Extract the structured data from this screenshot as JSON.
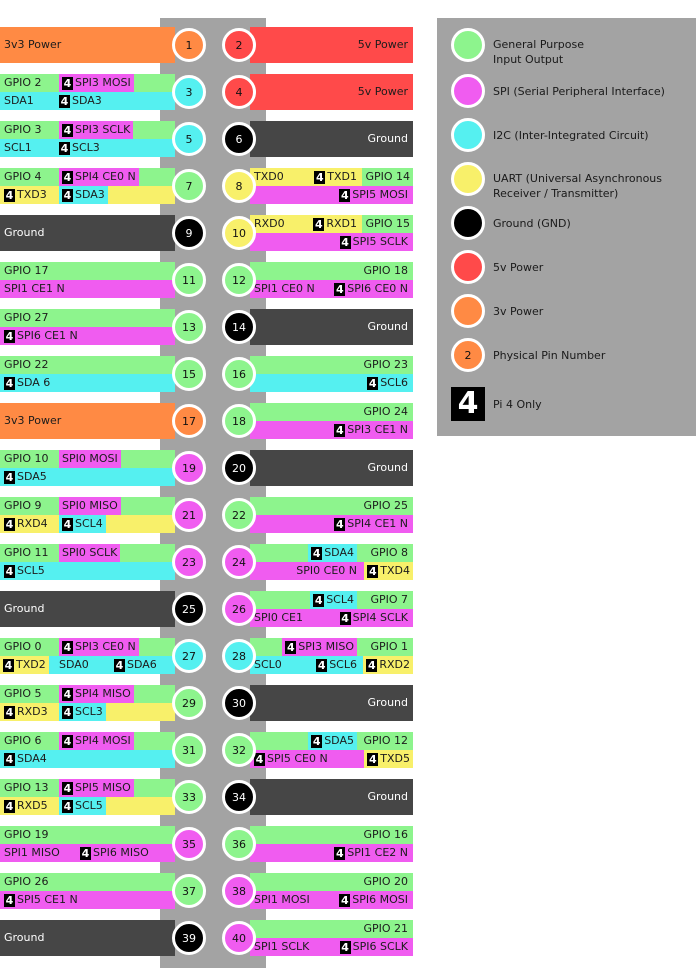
{
  "colors": {
    "gpio": "#8df48d",
    "spi": "#f05cf0",
    "i2c": "#55f0f0",
    "uart": "#f8f06a",
    "ground": "#464646",
    "power5": "#ff4a4a",
    "power3": "#ff8a44",
    "panel": "#a3a3a3"
  },
  "pins": [
    {
      "n": "1",
      "color": "power3"
    },
    {
      "n": "2",
      "color": "power5"
    },
    {
      "n": "3",
      "color": "i2c"
    },
    {
      "n": "4",
      "color": "power5"
    },
    {
      "n": "5",
      "color": "i2c"
    },
    {
      "n": "6",
      "color": "ground"
    },
    {
      "n": "7",
      "color": "gpio"
    },
    {
      "n": "8",
      "color": "uart"
    },
    {
      "n": "9",
      "color": "ground"
    },
    {
      "n": "10",
      "color": "uart"
    },
    {
      "n": "11",
      "color": "gpio"
    },
    {
      "n": "12",
      "color": "gpio"
    },
    {
      "n": "13",
      "color": "gpio"
    },
    {
      "n": "14",
      "color": "ground"
    },
    {
      "n": "15",
      "color": "gpio"
    },
    {
      "n": "16",
      "color": "gpio"
    },
    {
      "n": "17",
      "color": "power3"
    },
    {
      "n": "18",
      "color": "gpio"
    },
    {
      "n": "19",
      "color": "spi"
    },
    {
      "n": "20",
      "color": "ground"
    },
    {
      "n": "21",
      "color": "spi"
    },
    {
      "n": "22",
      "color": "gpio"
    },
    {
      "n": "23",
      "color": "spi"
    },
    {
      "n": "24",
      "color": "spi"
    },
    {
      "n": "25",
      "color": "ground"
    },
    {
      "n": "26",
      "color": "spi"
    },
    {
      "n": "27",
      "color": "i2c"
    },
    {
      "n": "28",
      "color": "i2c"
    },
    {
      "n": "29",
      "color": "gpio"
    },
    {
      "n": "30",
      "color": "ground"
    },
    {
      "n": "31",
      "color": "gpio"
    },
    {
      "n": "32",
      "color": "gpio"
    },
    {
      "n": "33",
      "color": "gpio"
    },
    {
      "n": "34",
      "color": "ground"
    },
    {
      "n": "35",
      "color": "spi"
    },
    {
      "n": "36",
      "color": "gpio"
    },
    {
      "n": "37",
      "color": "gpio"
    },
    {
      "n": "38",
      "color": "spi"
    },
    {
      "n": "39",
      "color": "ground"
    },
    {
      "n": "40",
      "color": "spi"
    }
  ],
  "left": [
    [
      {
        "full": true,
        "c": "power3",
        "segs": [
          {
            "t": "3v3 Power"
          }
        ]
      }
    ],
    [
      {
        "c": "gpio",
        "segs": [
          {
            "t": "GPIO 2"
          },
          {
            "t": "SPI3 MOSI",
            "b": "4",
            "pos": "ml",
            "bg": "spi"
          }
        ]
      },
      {
        "c": "i2c",
        "segs": [
          {
            "t": "SDA1"
          },
          {
            "t": "SDA3",
            "b": "4",
            "pos": "ml"
          }
        ]
      }
    ],
    [
      {
        "c": "gpio",
        "segs": [
          {
            "t": "GPIO 3"
          },
          {
            "t": "SPI3 SCLK",
            "b": "4",
            "pos": "ml",
            "bg": "spi"
          }
        ]
      },
      {
        "c": "i2c",
        "segs": [
          {
            "t": "SCL1"
          },
          {
            "t": "SCL3",
            "b": "4",
            "pos": "ml"
          }
        ]
      }
    ],
    [
      {
        "c": "gpio",
        "segs": [
          {
            "t": "GPIO 4"
          },
          {
            "t": "SPI4 CE0 N",
            "b": "4",
            "pos": "ml",
            "bg": "spi"
          }
        ]
      },
      {
        "c": "uart",
        "segs": [
          {
            "t": "TXD3",
            "b": "4"
          },
          {
            "t": "SDA3",
            "b": "4",
            "pos": "ml",
            "bg": "i2c"
          }
        ]
      }
    ],
    [
      {
        "full": true,
        "c": "ground",
        "segs": [
          {
            "t": "Ground"
          }
        ]
      }
    ],
    [
      {
        "c": "gpio",
        "segs": [
          {
            "t": "GPIO 17"
          }
        ]
      },
      {
        "c": "spi",
        "segs": [
          {
            "t": "SPI1 CE1 N"
          }
        ]
      }
    ],
    [
      {
        "c": "gpio",
        "segs": [
          {
            "t": "GPIO 27"
          }
        ]
      },
      {
        "c": "spi",
        "segs": [
          {
            "t": "SPI6 CE1 N",
            "b": "4"
          }
        ]
      }
    ],
    [
      {
        "c": "gpio",
        "segs": [
          {
            "t": "GPIO 22"
          }
        ]
      },
      {
        "c": "i2c",
        "segs": [
          {
            "t": "SDA 6",
            "b": "4"
          }
        ]
      }
    ],
    [
      {
        "full": true,
        "c": "power3",
        "segs": [
          {
            "t": "3v3 Power"
          }
        ]
      }
    ],
    [
      {
        "c": "gpio",
        "segs": [
          {
            "t": "GPIO 10"
          },
          {
            "t": "SPI0 MOSI",
            "pos": "ml",
            "bg": "spi"
          }
        ]
      },
      {
        "c": "i2c",
        "segs": [
          {
            "t": "SDA5",
            "b": "4"
          }
        ]
      }
    ],
    [
      {
        "c": "gpio",
        "segs": [
          {
            "t": "GPIO 9"
          },
          {
            "t": "SPI0 MISO",
            "pos": "ml",
            "bg": "spi"
          }
        ]
      },
      {
        "c": "uart",
        "segs": [
          {
            "t": "RXD4",
            "b": "4"
          },
          {
            "t": "SCL4",
            "b": "4",
            "pos": "ml",
            "bg": "i2c"
          }
        ]
      }
    ],
    [
      {
        "c": "gpio",
        "segs": [
          {
            "t": "GPIO 11"
          },
          {
            "t": "SPI0 SCLK",
            "pos": "ml",
            "bg": "spi"
          }
        ]
      },
      {
        "c": "i2c",
        "segs": [
          {
            "t": "SCL5",
            "b": "4"
          }
        ]
      }
    ],
    [
      {
        "full": true,
        "c": "ground",
        "segs": [
          {
            "t": "Ground"
          }
        ]
      }
    ],
    [
      {
        "c": "gpio",
        "segs": [
          {
            "t": "GPIO 0"
          },
          {
            "t": "SPI3 CE0 N",
            "b": "4",
            "pos": "ml",
            "bg": "spi"
          }
        ]
      },
      {
        "c": "i2c",
        "segs": [
          {
            "t": "TXD2",
            "b": "4",
            "bg": "uart"
          },
          {
            "t": "SDA0",
            "pos": "ml"
          },
          {
            "t": "SDA6",
            "b": "4",
            "pos": "x"
          }
        ]
      }
    ],
    [
      {
        "c": "gpio",
        "segs": [
          {
            "t": "GPIO 5"
          },
          {
            "t": "SPI4 MISO",
            "b": "4",
            "pos": "ml",
            "bg": "spi"
          }
        ]
      },
      {
        "c": "uart",
        "segs": [
          {
            "t": "RXD3",
            "b": "4"
          },
          {
            "t": "SCL3",
            "b": "4",
            "pos": "ml",
            "bg": "i2c"
          }
        ]
      }
    ],
    [
      {
        "c": "gpio",
        "segs": [
          {
            "t": "GPIO 6"
          },
          {
            "t": "SPI4 MOSI",
            "b": "4",
            "pos": "ml",
            "bg": "spi"
          }
        ]
      },
      {
        "c": "i2c",
        "segs": [
          {
            "t": "SDA4",
            "b": "4"
          }
        ]
      }
    ],
    [
      {
        "c": "gpio",
        "segs": [
          {
            "t": "GPIO 13"
          },
          {
            "t": "SPI5 MISO",
            "b": "4",
            "pos": "ml",
            "bg": "spi"
          }
        ]
      },
      {
        "c": "uart",
        "segs": [
          {
            "t": "RXD5",
            "b": "4"
          },
          {
            "t": "SCL5",
            "b": "4",
            "pos": "ml",
            "bg": "i2c"
          }
        ]
      }
    ],
    [
      {
        "c": "gpio",
        "segs": [
          {
            "t": "GPIO 19"
          }
        ]
      },
      {
        "c": "spi",
        "segs": [
          {
            "t": "SPI1 MISO"
          },
          {
            "t": "SPI6 MISO",
            "b": "4",
            "pos": "x2"
          }
        ]
      }
    ],
    [
      {
        "c": "gpio",
        "segs": [
          {
            "t": "GPIO 26"
          }
        ]
      },
      {
        "c": "spi",
        "segs": [
          {
            "t": "SPI5 CE1 N",
            "b": "4"
          }
        ]
      }
    ],
    [
      {
        "full": true,
        "c": "ground",
        "segs": [
          {
            "t": "Ground"
          }
        ]
      }
    ]
  ],
  "right": [
    [
      {
        "full": true,
        "c": "power5",
        "segs": [
          {
            "t": "5v Power"
          }
        ]
      }
    ],
    [
      {
        "full": true,
        "c": "power5",
        "segs": [
          {
            "t": "5v Power"
          }
        ]
      }
    ],
    [
      {
        "full": true,
        "c": "ground",
        "segs": [
          {
            "t": "Ground"
          }
        ]
      }
    ],
    [
      {
        "c": "uart",
        "segs": [
          {
            "t": "GPIO 14",
            "bg": "gpio"
          },
          {
            "t": "TXD0",
            "pos": "ll"
          },
          {
            "t": "TXD1",
            "b": "4",
            "pos": "mr"
          }
        ]
      },
      {
        "c": "spi",
        "segs": [
          {
            "t": "SPI5 MOSI",
            "b": "4"
          }
        ]
      }
    ],
    [
      {
        "c": "uart",
        "segs": [
          {
            "t": "GPIO 15",
            "bg": "gpio"
          },
          {
            "t": "RXD0",
            "pos": "ll"
          },
          {
            "t": "RXD1",
            "b": "4",
            "pos": "mr"
          }
        ]
      },
      {
        "c": "spi",
        "segs": [
          {
            "t": "SPI5 SCLK",
            "b": "4"
          }
        ]
      }
    ],
    [
      {
        "c": "gpio",
        "segs": [
          {
            "t": "GPIO 18"
          }
        ]
      },
      {
        "c": "spi",
        "segs": [
          {
            "t": "SPI6 CE0 N",
            "b": "4"
          },
          {
            "t": "SPI1 CE0 N",
            "pos": "ll"
          }
        ]
      }
    ],
    [
      {
        "full": true,
        "c": "ground",
        "segs": [
          {
            "t": "Ground"
          }
        ]
      }
    ],
    [
      {
        "c": "gpio",
        "segs": [
          {
            "t": "GPIO 23"
          }
        ]
      },
      {
        "c": "i2c",
        "segs": [
          {
            "t": "SCL6",
            "b": "4"
          }
        ]
      }
    ],
    [
      {
        "c": "gpio",
        "segs": [
          {
            "t": "GPIO 24"
          }
        ]
      },
      {
        "c": "spi",
        "segs": [
          {
            "t": "SPI3 CE1 N",
            "b": "4"
          }
        ]
      }
    ],
    [
      {
        "full": true,
        "c": "ground",
        "segs": [
          {
            "t": "Ground"
          }
        ]
      }
    ],
    [
      {
        "c": "gpio",
        "segs": [
          {
            "t": "GPIO 25"
          }
        ]
      },
      {
        "c": "spi",
        "segs": [
          {
            "t": "SPI4 CE1 N",
            "b": "4"
          }
        ]
      }
    ],
    [
      {
        "c": "gpio",
        "segs": [
          {
            "t": "GPIO 8"
          },
          {
            "t": "SDA4",
            "b": "4",
            "pos": "mr",
            "bg": "i2c"
          }
        ]
      },
      {
        "c": "spi",
        "segs": [
          {
            "t": "TXD4",
            "b": "4",
            "bg": "uart"
          },
          {
            "t": "SPI0 CE0 N",
            "pos": "mr"
          }
        ]
      }
    ],
    [
      {
        "c": "gpio",
        "segs": [
          {
            "t": "GPIO 7"
          },
          {
            "t": "SCL4",
            "b": "4",
            "pos": "mr",
            "bg": "i2c"
          }
        ]
      },
      {
        "c": "spi",
        "segs": [
          {
            "t": "SPI4 SCLK",
            "b": "4"
          },
          {
            "t": "SPI0 CE1",
            "pos": "ll"
          }
        ]
      }
    ],
    [
      {
        "c": "gpio",
        "segs": [
          {
            "t": "GPIO 1"
          },
          {
            "t": "SPI3 MISO",
            "b": "4",
            "pos": "mr",
            "bg": "spi"
          }
        ]
      },
      {
        "c": "i2c",
        "segs": [
          {
            "t": "RXD2",
            "b": "4",
            "bg": "uart"
          },
          {
            "t": "SCL0",
            "pos": "ll"
          },
          {
            "t": "SCL6",
            "b": "4",
            "pos": "mr"
          }
        ]
      }
    ],
    [
      {
        "full": true,
        "c": "ground",
        "segs": [
          {
            "t": "Ground"
          }
        ]
      }
    ],
    [
      {
        "c": "gpio",
        "segs": [
          {
            "t": "GPIO 12"
          },
          {
            "t": "SDA5",
            "b": "4",
            "pos": "mr",
            "bg": "i2c"
          }
        ]
      },
      {
        "c": "spi",
        "segs": [
          {
            "t": "TXD5",
            "b": "4",
            "bg": "uart"
          },
          {
            "t": "SPI5 CE0 N",
            "b": "4",
            "pos": "ll"
          }
        ]
      }
    ],
    [
      {
        "full": true,
        "c": "ground",
        "segs": [
          {
            "t": "Ground"
          }
        ]
      }
    ],
    [
      {
        "c": "gpio",
        "segs": [
          {
            "t": "GPIO 16"
          }
        ]
      },
      {
        "c": "spi",
        "segs": [
          {
            "t": "SPI1 CE2 N",
            "b": "4"
          }
        ]
      }
    ],
    [
      {
        "c": "gpio",
        "segs": [
          {
            "t": "GPIO 20"
          }
        ]
      },
      {
        "c": "spi",
        "segs": [
          {
            "t": "SPI6 MOSI",
            "b": "4"
          },
          {
            "t": "SPI1 MOSI",
            "pos": "ll"
          }
        ]
      }
    ],
    [
      {
        "c": "gpio",
        "segs": [
          {
            "t": "GPIO 21"
          }
        ]
      },
      {
        "c": "spi",
        "segs": [
          {
            "t": "SPI6 SCLK",
            "b": "4"
          },
          {
            "t": "SPI1 SCLK",
            "pos": "ll"
          }
        ]
      }
    ]
  ],
  "legend": [
    {
      "color": "gpio",
      "label": "General Purpose\nInput Output"
    },
    {
      "color": "spi",
      "label": "SPI (Serial Peripheral Interface)"
    },
    {
      "color": "i2c",
      "label": "I2C (Inter-Integrated Circuit)"
    },
    {
      "color": "uart",
      "label": "UART (Universal Asynchronous\nReceiver / Transmitter)"
    },
    {
      "color": "black",
      "label": "Ground (GND)"
    },
    {
      "color": "power5",
      "label": "5v Power"
    },
    {
      "color": "power3",
      "label": "3v Power"
    },
    {
      "color": "power3",
      "num": "2",
      "label": "Physical Pin Number"
    },
    {
      "badge": "4",
      "label": "Pi 4 Only"
    }
  ]
}
